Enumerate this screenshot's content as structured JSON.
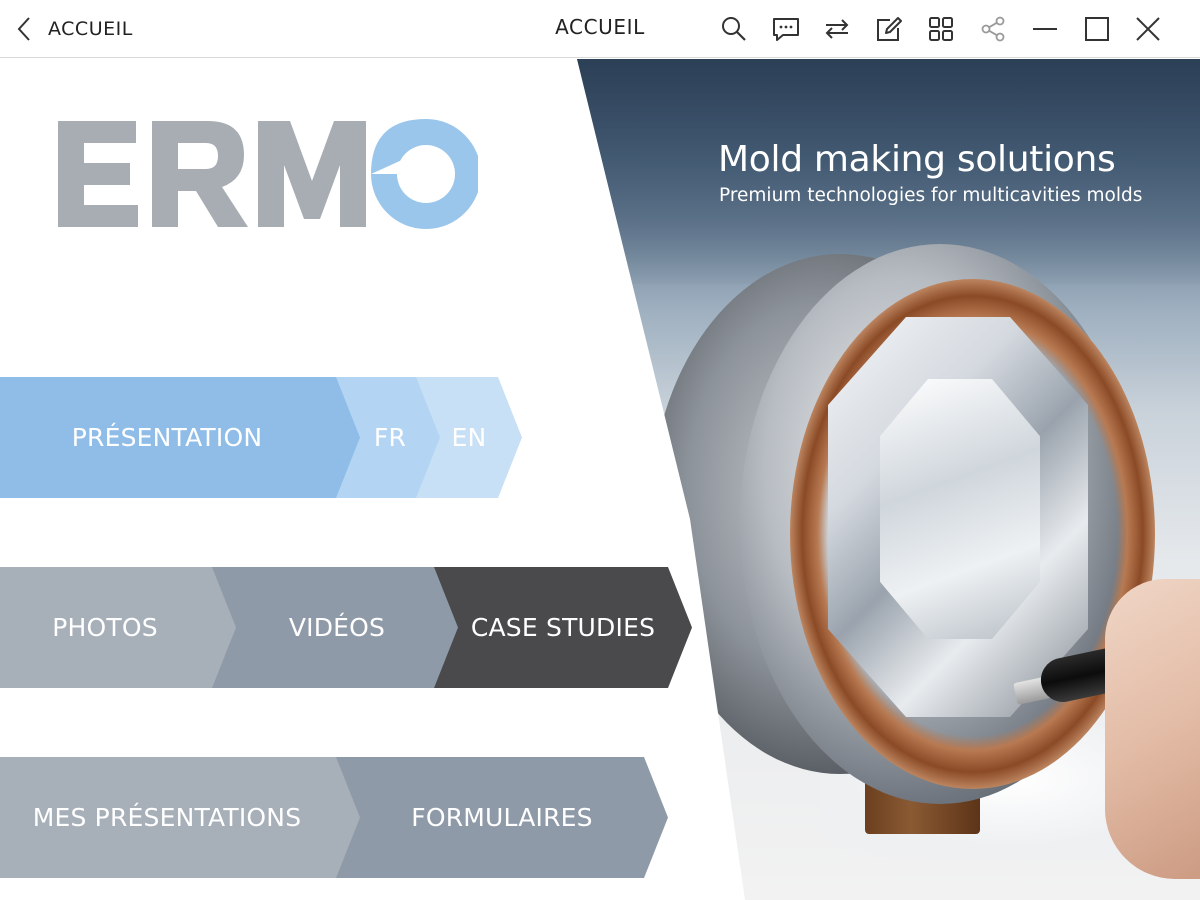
{
  "topbar": {
    "back_label": "ACCUEIL",
    "title": "ACCUEIL",
    "tools": [
      "search-icon",
      "comment-icon",
      "sync-icon",
      "edit-icon",
      "grid-icon",
      "share-icon",
      "minimize-icon",
      "maximize-icon",
      "close-icon"
    ]
  },
  "logo": {
    "text": "ERMO"
  },
  "hero": {
    "title": "Mold making solutions",
    "subtitle": "Premium technologies for multicavities molds"
  },
  "menu": {
    "presentation": "PRÉSENTATION",
    "fr": "FR",
    "en": "EN",
    "photos": "PHOTOS",
    "videos": "VIDÉOS",
    "case_studies": "CASE STUDIES",
    "mes_presentations": "MES PRÉSENTATIONS",
    "formulaires": "FORMULAIRES"
  },
  "colors": {
    "blue_primary": "#8fbde8",
    "blue_light": "#b3d5f3",
    "blue_lighter": "#c7e0f6",
    "grey_light": "#a7afb9",
    "grey_mid": "#8f9aa8",
    "grey_dark": "#4a4a4c",
    "logo_grey": "#a8adb4",
    "logo_blue": "#9ac6ec"
  }
}
